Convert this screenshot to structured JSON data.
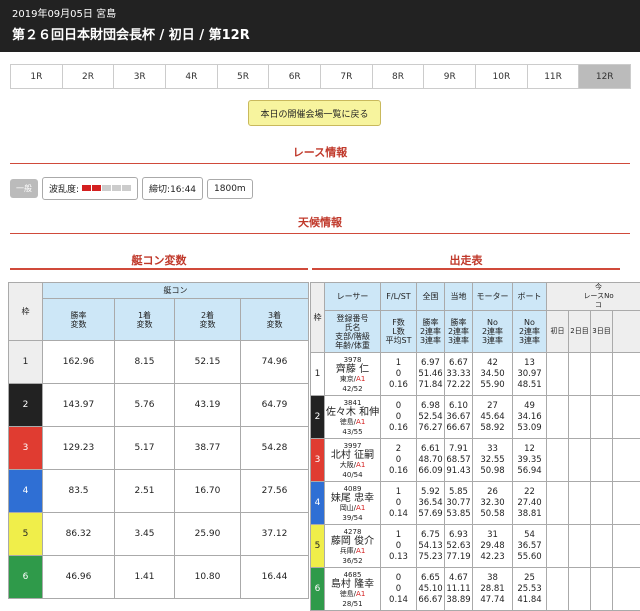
{
  "header": {
    "date_venue": "2019年09月05日 宮島",
    "title": "第２６回日本財団会長杯 / 初日 / 第12R"
  },
  "tabs": [
    "1R",
    "2R",
    "3R",
    "4R",
    "5R",
    "6R",
    "7R",
    "8R",
    "9R",
    "10R",
    "11R",
    "12R"
  ],
  "active_tab": "12R",
  "back_button": "本日の開催会場一覧に戻る",
  "race_info": {
    "title": "レース情報",
    "grade": "一般",
    "wave_label": "波乱度:",
    "wave_level": 2,
    "wave_max": 5,
    "deadline": "締切:16:44",
    "distance": "1800m"
  },
  "weather_title": "天候情報",
  "odds_panel": {
    "title": "艇コン変数",
    "waku_header": "枠",
    "group_header": "艇コン",
    "cols": [
      "勝率\n変数",
      "1着\n変数",
      "2着\n変数",
      "3着\n変数"
    ]
  },
  "entry_panel": {
    "title": "出走表",
    "cols": [
      "枠",
      "レーサー",
      "F/L/ST",
      "全国",
      "当地",
      "モーター",
      "ボート"
    ],
    "subcols": {
      "racer": "登録番号\n氏名\n支部/階級\n年齢/体重",
      "fls": "F数\nL数\n平均ST",
      "national": "勝率\n2連率\n3連率",
      "local": "勝率\n2連率\n3連率",
      "motor": "No\n2連率\n3連率",
      "boat": "No\n2連率\n3連率"
    },
    "extra_header": "今\nレースNo\nコ",
    "days": [
      "初日",
      "2日目",
      "3日目"
    ]
  },
  "boats": [
    {
      "waku": "1",
      "odds": [
        "162.96",
        "8.15",
        "52.15",
        "74.96"
      ],
      "reg": "3978",
      "name": "齊藤 仁",
      "branch": "東京/",
      "cls": "A1",
      "age": "42/52",
      "fls": [
        "1",
        "0",
        "0.16"
      ],
      "nat": [
        "6.97",
        "51.46",
        "71.84"
      ],
      "loc": [
        "6.67",
        "33.33",
        "72.22"
      ],
      "motor": [
        "42",
        "34.50",
        "55.90"
      ],
      "boat": [
        "13",
        "30.97",
        "48.51"
      ]
    },
    {
      "waku": "2",
      "odds": [
        "143.97",
        "5.76",
        "43.19",
        "64.79"
      ],
      "reg": "3841",
      "name": "佐々木 和伸",
      "branch": "徳島/",
      "cls": "A1",
      "age": "43/55",
      "fls": [
        "0",
        "0",
        "0.16"
      ],
      "nat": [
        "6.98",
        "52.54",
        "76.27"
      ],
      "loc": [
        "6.10",
        "36.67",
        "66.67"
      ],
      "motor": [
        "27",
        "45.64",
        "58.92"
      ],
      "boat": [
        "49",
        "34.16",
        "53.09"
      ]
    },
    {
      "waku": "3",
      "odds": [
        "129.23",
        "5.17",
        "38.77",
        "54.28"
      ],
      "reg": "3997",
      "name": "北村 征嗣",
      "branch": "大阪/",
      "cls": "A1",
      "age": "40/54",
      "fls": [
        "2",
        "0",
        "0.16"
      ],
      "nat": [
        "6.61",
        "48.70",
        "66.09"
      ],
      "loc": [
        "7.91",
        "68.57",
        "91.43"
      ],
      "motor": [
        "33",
        "32.55",
        "50.98"
      ],
      "boat": [
        "12",
        "39.35",
        "56.94"
      ]
    },
    {
      "waku": "4",
      "odds": [
        "83.5",
        "2.51",
        "16.70",
        "27.56"
      ],
      "reg": "4089",
      "name": "妹尾 忠幸",
      "branch": "岡山/",
      "cls": "A1",
      "age": "39/54",
      "fls": [
        "1",
        "0",
        "0.14"
      ],
      "nat": [
        "5.92",
        "36.54",
        "57.69"
      ],
      "loc": [
        "5.85",
        "30.77",
        "53.85"
      ],
      "motor": [
        "26",
        "32.30",
        "50.58"
      ],
      "boat": [
        "22",
        "27.40",
        "38.81"
      ]
    },
    {
      "waku": "5",
      "odds": [
        "86.32",
        "3.45",
        "25.90",
        "37.12"
      ],
      "reg": "4278",
      "name": "藤岡 俊介",
      "branch": "兵庫/",
      "cls": "A1",
      "age": "36/52",
      "fls": [
        "1",
        "0",
        "0.13"
      ],
      "nat": [
        "6.75",
        "54.13",
        "75.23"
      ],
      "loc": [
        "6.93",
        "52.63",
        "77.19"
      ],
      "motor": [
        "31",
        "29.48",
        "42.23"
      ],
      "boat": [
        "54",
        "36.57",
        "55.60"
      ]
    },
    {
      "waku": "6",
      "odds": [
        "46.96",
        "1.41",
        "10.80",
        "16.44"
      ],
      "reg": "4685",
      "name": "島村 隆幸",
      "branch": "徳島/",
      "cls": "A1",
      "age": "28/51",
      "fls": [
        "0",
        "0",
        "0.14"
      ],
      "nat": [
        "6.65",
        "45.10",
        "66.67"
      ],
      "loc": [
        "4.67",
        "11.11",
        "38.89"
      ],
      "motor": [
        "38",
        "28.81",
        "47.74"
      ],
      "boat": [
        "25",
        "25.53",
        "41.84"
      ]
    }
  ]
}
